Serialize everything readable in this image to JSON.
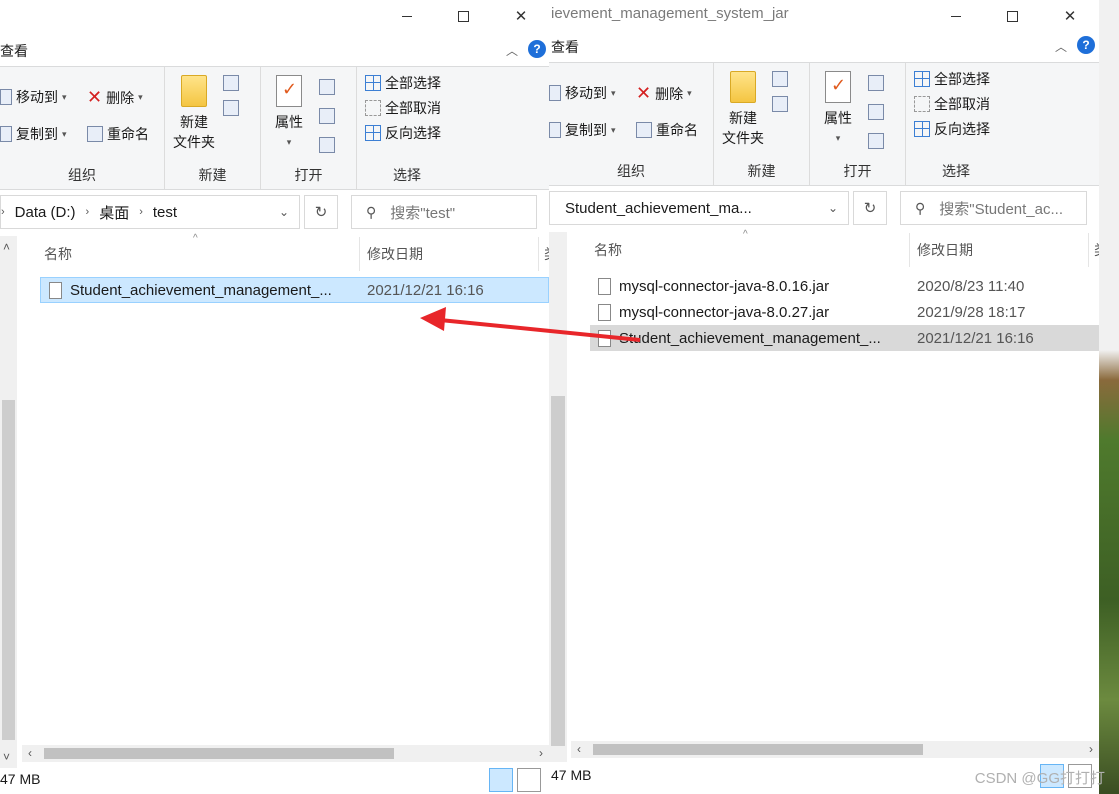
{
  "left_window": {
    "window_controls": {
      "minimize": "",
      "maximize": "",
      "close": "✕"
    },
    "view_tab": "查看",
    "help": "?",
    "ribbon": {
      "organize": {
        "move_to": "移动到",
        "copy_to": "复制到",
        "delete": "删除",
        "rename": "重命名",
        "label": "组织"
      },
      "new": {
        "new_folder_line1": "新建",
        "new_folder_line2": "文件夹",
        "label": "新建"
      },
      "open": {
        "properties": "属性",
        "label": "打开"
      },
      "select": {
        "select_all": "全部选择",
        "select_none": "全部取消",
        "invert": "反向选择",
        "label": "选择"
      }
    },
    "breadcrumb": [
      "Data (D:)",
      "桌面",
      "test"
    ],
    "search_placeholder": "搜索\"test\"",
    "columns": {
      "name": "名称",
      "modified": "修改日期",
      "extra": "类"
    },
    "files": [
      {
        "name": "Student_achievement_management_...",
        "date": "2021/12/21 16:16"
      }
    ],
    "status": "47 MB"
  },
  "right_window": {
    "title": "ievement_management_system_jar",
    "window_controls": {
      "minimize": "",
      "maximize": "",
      "close": "✕"
    },
    "view_tab": "查看",
    "help": "?",
    "ribbon": {
      "organize": {
        "move_to": "移动到",
        "copy_to": "复制到",
        "delete": "删除",
        "rename": "重命名",
        "label": "组织"
      },
      "new": {
        "new_folder_line1": "新建",
        "new_folder_line2": "文件夹",
        "label": "新建"
      },
      "open": {
        "properties": "属性",
        "label": "打开"
      },
      "select": {
        "select_all": "全部选择",
        "select_none": "全部取消",
        "invert": "反向选择",
        "label": "选择"
      }
    },
    "breadcrumb": [
      "Student_achievement_ma..."
    ],
    "search_placeholder": "搜索\"Student_ac...",
    "columns": {
      "name": "名称",
      "modified": "修改日期",
      "extra": "类"
    },
    "files": [
      {
        "name": "mysql-connector-java-8.0.16.jar",
        "date": "2020/8/23 11:40"
      },
      {
        "name": "mysql-connector-java-8.0.27.jar",
        "date": "2021/9/28 18:17"
      },
      {
        "name": "Student_achievement_management_...",
        "date": "2021/12/21 16:16"
      }
    ],
    "status": "47 MB"
  },
  "watermark": "CSDN @GG打打打",
  "colors": {
    "arrow": "#e8262a",
    "selection": "#cce8ff",
    "help": "#1e6fd9"
  }
}
